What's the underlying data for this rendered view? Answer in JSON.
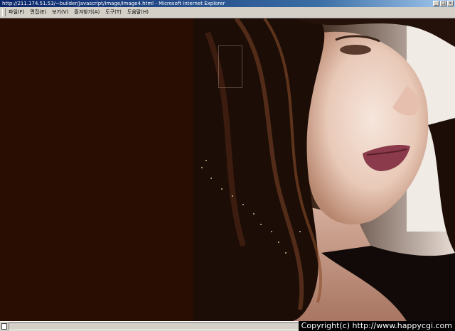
{
  "window": {
    "title": "http://211.174.51.53/~builder/Javascript/Image/Image4.html - Microsoft Internet Explorer",
    "controls": [
      "_",
      "□",
      "×"
    ]
  },
  "menubar": {
    "items": [
      {
        "label": "파일(F)"
      },
      {
        "label": "편집(E)"
      },
      {
        "label": "보기(V)"
      },
      {
        "label": "즐겨찾기(A)"
      },
      {
        "label": "도구(T)"
      },
      {
        "label": "도움말(H)"
      }
    ]
  },
  "content": {
    "left_panel_color": "#290d03",
    "photo_subject": "woman-portrait"
  },
  "footer": {
    "copyright": "Copyright(c) http://www.happycgi.com"
  }
}
